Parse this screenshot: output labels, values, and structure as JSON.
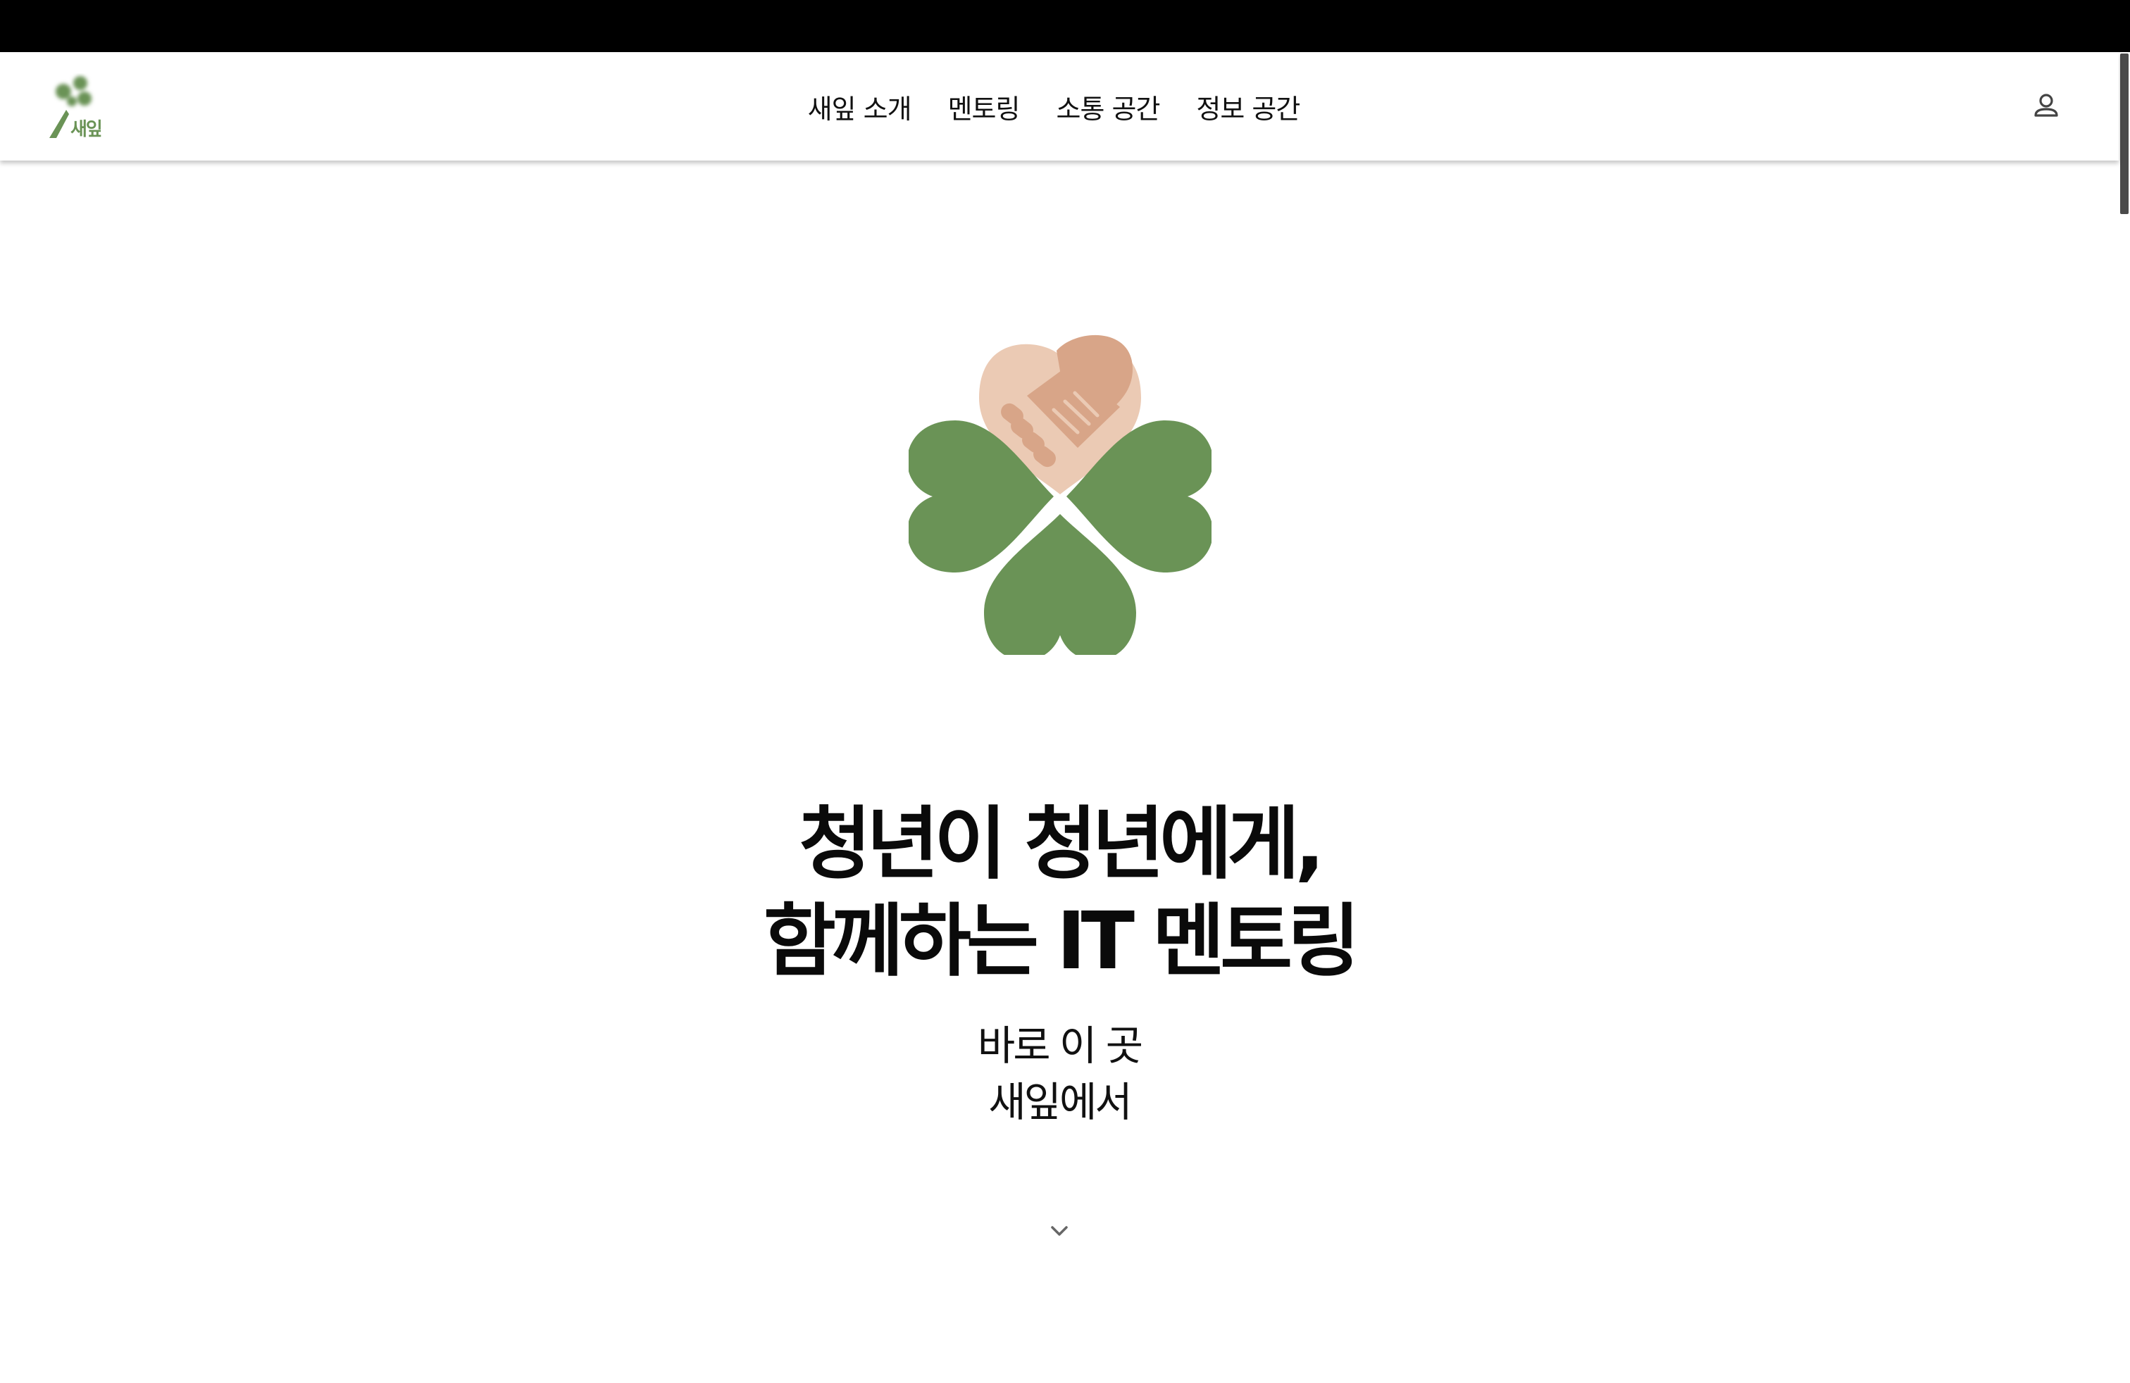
{
  "header": {
    "logo_text": "새잎",
    "nav": [
      {
        "label": "새잎 소개"
      },
      {
        "label": "멘토링"
      },
      {
        "label": "소통 공간"
      },
      {
        "label": "정보 공간"
      }
    ],
    "user_icon": "user-icon"
  },
  "hero": {
    "graphic_icon": "clover-handshake-icon",
    "headline": {
      "line1": "청년이 청년에게,",
      "line2": "함께하는 IT 멘토링"
    },
    "subline": {
      "line1": "바로 이 곳",
      "line2": "새잎에서"
    },
    "scroll_icon": "chevron-down-icon"
  },
  "colors": {
    "leaf_green": "#6a9356",
    "hand_light": "#ebcab4",
    "hand_dark": "#d8a588",
    "topbar": "#000000",
    "scrollbar_thumb": "#4a4a4a"
  }
}
